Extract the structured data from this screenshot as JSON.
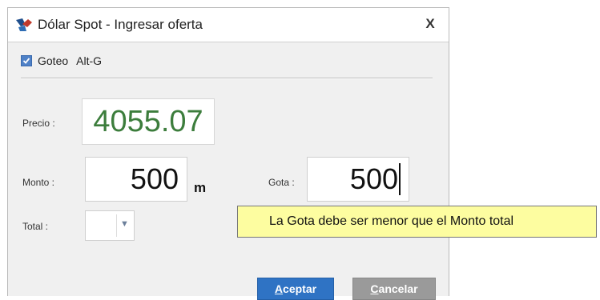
{
  "dialog": {
    "title": "Dólar Spot - Ingresar oferta",
    "close_label": "X"
  },
  "goteo": {
    "checked": true,
    "label": "Goteo",
    "shortcut": "Alt-G"
  },
  "fields": {
    "precio_label": "Precio :",
    "precio_value": "4055.07",
    "monto_label": "Monto :",
    "monto_value": "500",
    "monto_unit": "m",
    "gota_label": "Gota :",
    "gota_value": "500",
    "total_label": "Total :",
    "total_value": ""
  },
  "buttons": {
    "accept_mnemonic": "A",
    "accept_rest": "ceptar",
    "cancel_mnemonic": "C",
    "cancel_rest": "ancelar"
  },
  "tooltip": {
    "text": "La Gota debe ser menor que el Monto total"
  },
  "colors": {
    "price_text": "#3c7d3c",
    "accept_button": "#2f73c4",
    "cancel_button": "#9a9a9a",
    "tooltip_bg": "#fdfda0"
  }
}
